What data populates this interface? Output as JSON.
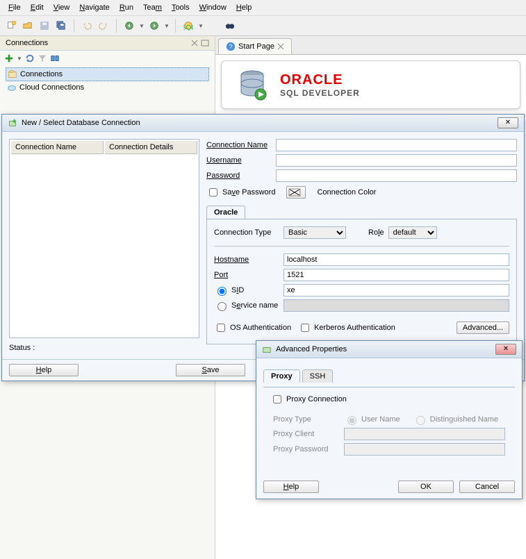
{
  "menu": [
    "File",
    "Edit",
    "View",
    "Navigate",
    "Run",
    "Team",
    "Tools",
    "Window",
    "Help"
  ],
  "left": {
    "title": "Connections",
    "items": [
      "Connections",
      "Cloud Connections"
    ]
  },
  "tab": {
    "start": "Start Page"
  },
  "logo": {
    "brand": "ORACLE",
    "product": "SQL DEVELOPER"
  },
  "conn": {
    "title": "New / Select Database Connection",
    "cols": [
      "Connection Name",
      "Connection Details"
    ],
    "labels": {
      "name": "Connection Name",
      "user": "Username",
      "pass": "Password",
      "savepw": "Save Password",
      "color_lbl": "Connection Color",
      "tab": "Oracle",
      "ctype": "Connection Type",
      "role": "Role",
      "host": "Hostname",
      "port": "Port",
      "sid": "SID",
      "svc": "Service name",
      "osauth": "OS Authentication",
      "kerb": "Kerberos Authentication",
      "adv": "Advanced..."
    },
    "values": {
      "ctype": "Basic",
      "role": "default",
      "host": "localhost",
      "port": "1521",
      "sid": "xe"
    },
    "status": "Status :",
    "btns": {
      "help": "Help",
      "save": "Save"
    }
  },
  "adv": {
    "title": "Advanced Properties",
    "tabs": [
      "Proxy",
      "SSH"
    ],
    "labels": {
      "proxyconn": "Proxy Connection",
      "ptype": "Proxy Type",
      "uname": "User Name",
      "dname": "Distinguished Name",
      "pclient": "Proxy Client",
      "ppass": "Proxy Password"
    },
    "btns": {
      "help": "Help",
      "ok": "OK",
      "cancel": "Cancel"
    }
  }
}
